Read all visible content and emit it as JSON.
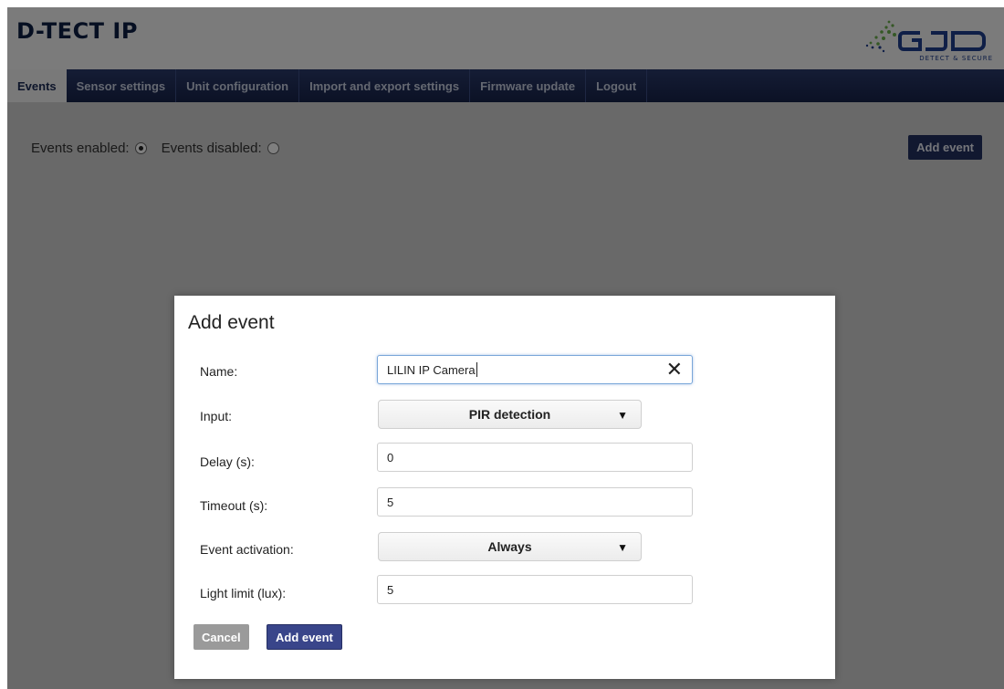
{
  "app": {
    "title": "D-TECT IP",
    "logo_text": "GJD",
    "logo_tagline": "DETECT & SECURE"
  },
  "nav": {
    "tabs": [
      {
        "label": "Events"
      },
      {
        "label": "Sensor settings"
      },
      {
        "label": "Unit configuration"
      },
      {
        "label": "Import and export settings"
      },
      {
        "label": "Firmware update"
      },
      {
        "label": "Logout"
      }
    ],
    "active_tab": "Events"
  },
  "events_page": {
    "enabled_label": "Events enabled:",
    "disabled_label": "Events disabled:",
    "selected": "enabled",
    "add_event_button": "Add event"
  },
  "modal": {
    "title": "Add event",
    "fields": {
      "name": {
        "label": "Name:",
        "value": "LILIN IP Camera"
      },
      "input": {
        "label": "Input:",
        "value": "PIR detection"
      },
      "delay": {
        "label": "Delay (s):",
        "value": "0"
      },
      "timeout": {
        "label": "Timeout (s):",
        "value": "5"
      },
      "activation": {
        "label": "Event activation:",
        "value": "Always"
      },
      "light_limit": {
        "label": "Light limit (lux):",
        "value": "5"
      }
    },
    "cancel_button": "Cancel",
    "submit_button": "Add event"
  },
  "colors": {
    "nav_bg": "#1d2a55",
    "title_color": "#0d1f44",
    "primary_button": "#39458a",
    "cancel_button": "#9a9a9a",
    "logo_green": "#6ab04c",
    "logo_blue": "#1f3f8f"
  }
}
